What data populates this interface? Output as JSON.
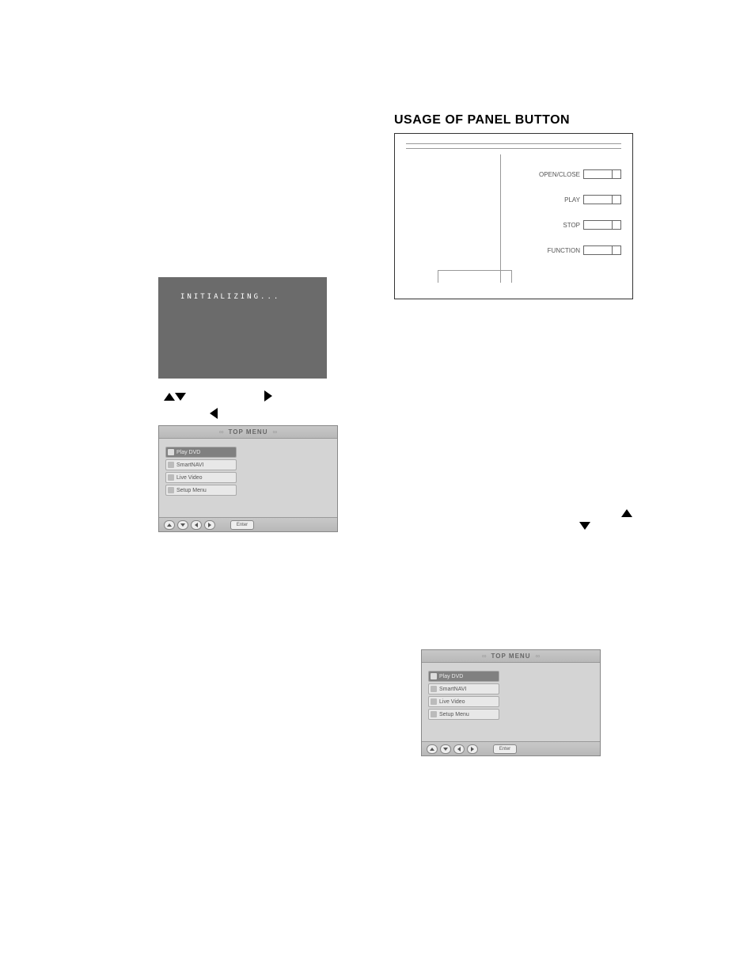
{
  "title": "USAGE OF PANEL BUTTON",
  "panel": {
    "buttons": [
      "OPEN/CLOSE",
      "PLAY",
      "STOP",
      "FUNCTION"
    ]
  },
  "init_screen": {
    "text": "INITIALIZING..."
  },
  "top_menu": {
    "title": "TOP MENU",
    "items": [
      "Play DVD",
      "SmartNAVI",
      "Live Video",
      "Setup Menu"
    ],
    "enter_label": "Enter"
  }
}
